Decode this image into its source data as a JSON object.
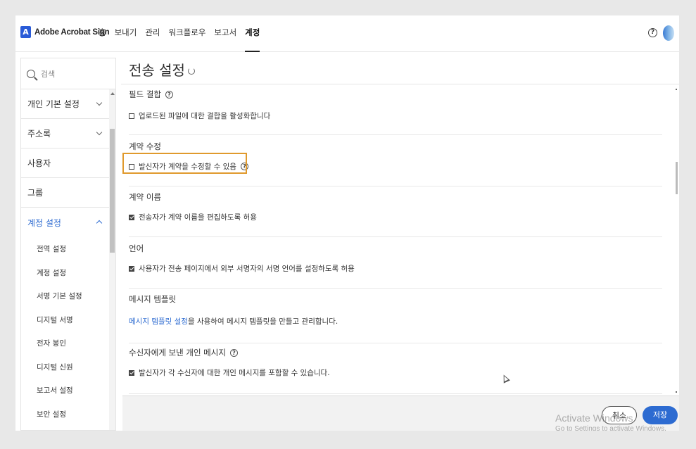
{
  "header": {
    "brand": "Adobe Acrobat Sign",
    "brand_logo_glyph": "A",
    "nav": [
      {
        "label": "홈"
      },
      {
        "label": "보내기"
      },
      {
        "label": "관리"
      },
      {
        "label": "워크플로우"
      },
      {
        "label": "보고서"
      },
      {
        "label": "계정",
        "active": true
      }
    ],
    "help_glyph": "?"
  },
  "sidebar": {
    "search_placeholder": "검색",
    "items": [
      {
        "label": "개인 기본 설정",
        "expandable": true
      },
      {
        "label": "주소록",
        "expandable": true
      },
      {
        "label": "사용자"
      },
      {
        "label": "그룹"
      },
      {
        "label": "계정 설정",
        "expandable": true,
        "open": true
      }
    ],
    "subitems": [
      {
        "label": "전역 설정"
      },
      {
        "label": "계정 설정"
      },
      {
        "label": "서명 기본 설정"
      },
      {
        "label": "디지털 서명"
      },
      {
        "label": "전자 봉인"
      },
      {
        "label": "디지털 신원"
      },
      {
        "label": "보고서 설정"
      },
      {
        "label": "보안 설정"
      }
    ]
  },
  "main": {
    "title": "전송 설정",
    "sections": [
      {
        "title": "필드 결합",
        "has_help": true,
        "option": "업로드된 파일에 대한 결합을 활성화합니다",
        "checked": false
      },
      {
        "title": "계약 수정",
        "has_help": false,
        "option": "발신자가 계약을 수정할 수 있음",
        "option_help": true,
        "checked": false,
        "highlighted": true
      },
      {
        "title": "계약 이름",
        "has_help": false,
        "option": "전송자가 계약 이름을 편집하도록 허용",
        "checked": true
      },
      {
        "title": "언어",
        "has_help": false,
        "option": "사용자가 전송 페이지에서 외부 서명자의 서명 언어를 설정하도록 허용",
        "checked": true
      },
      {
        "title": "메시지 템플릿",
        "has_help": false,
        "link_text": "메시지 템플릿 설정",
        "link_suffix": "을 사용하여 메시지 템플릿을 만들고 관리합니다."
      },
      {
        "title": "수신자에게 보낸 개인 메시지",
        "has_help": true,
        "option": "발신자가 각 수신자에 대한 개인 메시지를 포함할 수 있습니다.",
        "checked": true
      }
    ]
  },
  "footer": {
    "cancel_label": "취소",
    "save_label": "저장"
  },
  "watermark": {
    "line1": "Activate Windows",
    "line2": "Go to Settings to activate Windows."
  },
  "colors": {
    "accent": "#2d6bd1",
    "highlight_border": "#e09a2d"
  }
}
